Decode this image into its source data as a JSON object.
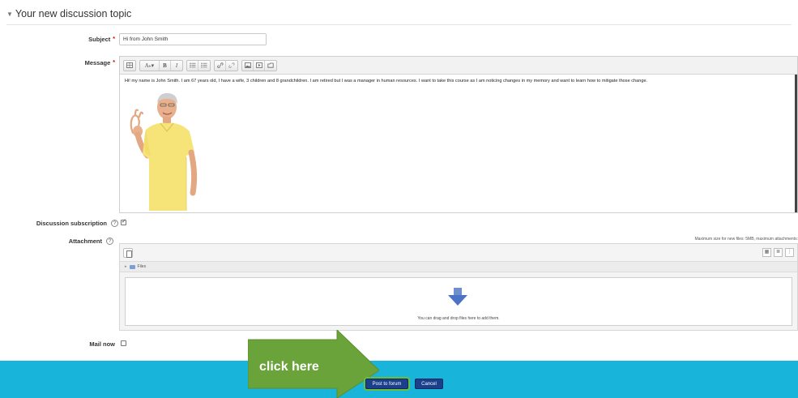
{
  "form": {
    "legend": "Your new discussion topic",
    "subject": {
      "label": "Subject",
      "required_mark": "*",
      "value": "Hi from John Smith"
    },
    "message": {
      "label": "Message",
      "required_mark": "*",
      "toolbar": [
        "table-icon",
        "font-icon",
        "bold-icon",
        "italic-icon",
        "unordered-list-icon",
        "ordered-list-icon",
        "link-icon",
        "unlink-icon",
        "image-icon",
        "media-icon",
        "manage-files-icon"
      ],
      "bold_glyph": "B",
      "italic_glyph": "I",
      "font_glyph": "Aₕ▾",
      "body": "Hi! my name is John Smith.  I am 67 years old, I have a wife, 3 children and 8 grandchildren.  I am retired but I was a manager in human resources.  I want to take this course as I am noticing changes in my memory and want to learn how to mitigate those change."
    },
    "subscription": {
      "label": "Discussion subscription",
      "help": "?",
      "checked": true
    },
    "attachment": {
      "label": "Attachment",
      "help": "?",
      "note": "Maximum size for new files: 5MB, maximum attachments:",
      "path_label": "Files",
      "drop_text": "You can drag and drop files here to add them."
    },
    "mail_now": {
      "label": "Mail now",
      "checked": false
    }
  },
  "buttons": {
    "post": "Post to forum",
    "cancel": "Cancel"
  },
  "callout": {
    "text": "click here"
  },
  "colors": {
    "footer": "#19b4da",
    "button": "#1b3f8b",
    "callout": "#6aa33a",
    "required": "#cc0000"
  }
}
